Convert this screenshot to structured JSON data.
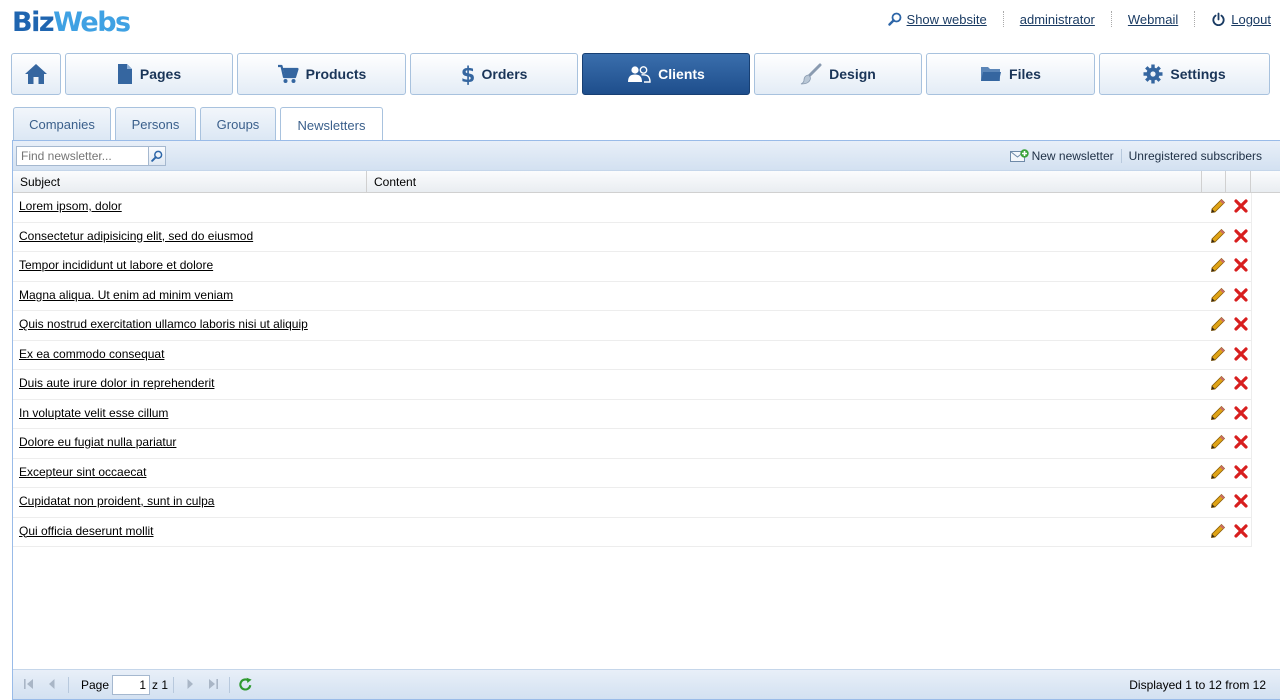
{
  "header": {
    "logo_part1": "Biz",
    "logo_part2": "Webs",
    "links": {
      "show_website": "Show website",
      "administrator": "administrator",
      "webmail": "Webmail",
      "logout": "Logout"
    }
  },
  "nav": {
    "home_icon": "home-icon",
    "items": [
      {
        "label": "Pages",
        "icon": "page-icon"
      },
      {
        "label": "Products",
        "icon": "cart-icon"
      },
      {
        "label": "Orders",
        "icon": "dollar-icon"
      },
      {
        "label": "Clients",
        "icon": "users-icon"
      },
      {
        "label": "Design",
        "icon": "brush-icon"
      },
      {
        "label": "Files",
        "icon": "folder-icon"
      },
      {
        "label": "Settings",
        "icon": "gear-icon"
      }
    ],
    "active": "Clients"
  },
  "subtabs": {
    "items": [
      "Companies",
      "Persons",
      "Groups",
      "Newsletters"
    ],
    "active": "Newsletters"
  },
  "toolbar": {
    "search_placeholder": "Find newsletter...",
    "new_newsletter": "New newsletter",
    "unregistered": "Unregistered subscribers"
  },
  "grid": {
    "columns": [
      "Subject",
      "Content"
    ],
    "rows": [
      "Lorem ipsom, dolor",
      "Consectetur adipisicing elit, sed do eiusmod",
      "Tempor incididunt ut labore et dolore",
      "Magna aliqua. Ut enim ad minim veniam",
      "Quis nostrud exercitation ullamco laboris nisi ut aliquip",
      "Ex ea commodo consequat",
      "Duis aute irure dolor in reprehenderit",
      "In voluptate velit esse cillum",
      "Dolore eu fugiat nulla pariatur",
      "Excepteur sint occaecat",
      "Cupidatat non proident, sunt in culpa",
      "Qui officia deserunt mollit"
    ]
  },
  "pager": {
    "page_label": "Page",
    "page_value": "1",
    "of_label": "z 1",
    "info": "Displayed 1 to 12 from 12"
  },
  "colors": {
    "active_nav": "#1e4e8c",
    "brand_dark": "#1f65b0",
    "brand_light": "#3fa1e3",
    "delete_red": "#d81e1e",
    "edit_gold": "#d99a12"
  }
}
